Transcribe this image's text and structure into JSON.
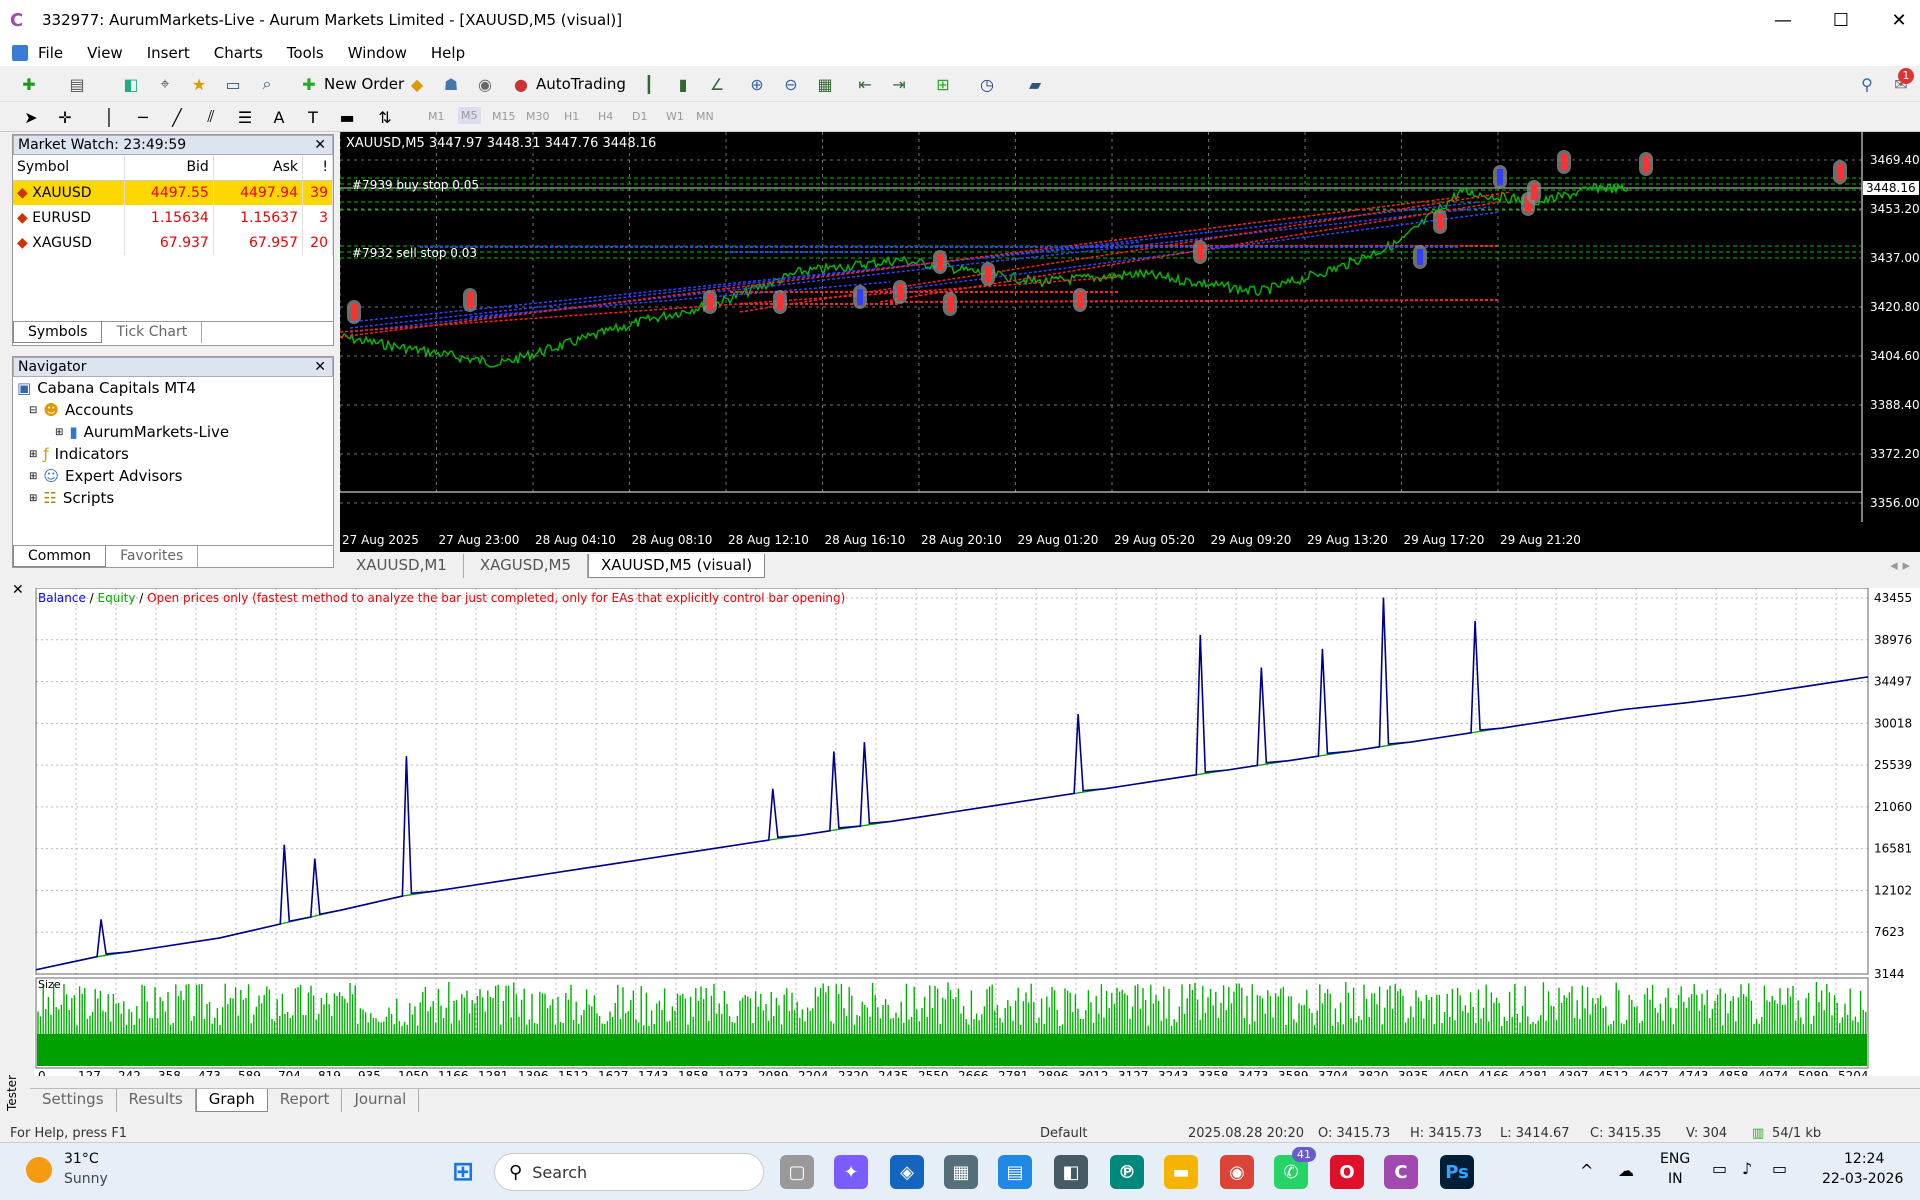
{
  "window": {
    "title": "332977: AurumMarkets-Live - Aurum Markets Limited - [XAUUSD,M5 (visual)]",
    "min": "—",
    "max": "☐",
    "close": "✕"
  },
  "menu": [
    "File",
    "View",
    "Insert",
    "Charts",
    "Tools",
    "Window",
    "Help"
  ],
  "toolbar": {
    "new_order": "New Order",
    "autotrading": "AutoTrading",
    "timeframes": [
      "M1",
      "M5",
      "M15",
      "M30",
      "H1",
      "H4",
      "D1",
      "W1",
      "MN"
    ],
    "alert_count": "1"
  },
  "market_watch": {
    "title": "Market Watch: 23:49:59",
    "headers": {
      "symbol": "Symbol",
      "bid": "Bid",
      "ask": "Ask",
      "spread": "!"
    },
    "rows": [
      {
        "symbol": "XAUUSD",
        "bid": "4497.55",
        "ask": "4497.94",
        "spread": "39"
      },
      {
        "symbol": "EURUSD",
        "bid": "1.15634",
        "ask": "1.15637",
        "spread": "3"
      },
      {
        "symbol": "XAGUSD",
        "bid": "67.937",
        "ask": "67.957",
        "spread": "20"
      }
    ],
    "tabs": [
      "Symbols",
      "Tick Chart"
    ]
  },
  "navigator": {
    "title": "Navigator",
    "root": "Cabana Capitals MT4",
    "accounts": "Accounts",
    "account": "AurumMarkets-Live",
    "indicators": "Indicators",
    "experts": "Expert Advisors",
    "scripts": "Scripts",
    "tabs": [
      "Common",
      "Favorites"
    ]
  },
  "price_chart": {
    "header": "XAUUSD,M5  3447.97 3448.31 3447.76 3448.16",
    "order_label_buy": "#7939 buy stop 0.05",
    "order_label_sell": "#7932 sell stop 0.03",
    "current_price": "3448.16",
    "y_ticks": [
      "3469.40",
      "3453.20",
      "3437.00",
      "3420.80",
      "3404.60",
      "3388.40",
      "3372.20",
      "3356.00"
    ],
    "x_ticks": [
      "27 Aug 2025",
      "27 Aug 23:00",
      "28 Aug 04:10",
      "28 Aug 08:10",
      "28 Aug 12:10",
      "28 Aug 16:10",
      "28 Aug 20:10",
      "29 Aug 01:20",
      "29 Aug 05:20",
      "29 Aug 09:20",
      "29 Aug 13:20",
      "29 Aug 17:20",
      "29 Aug 21:20"
    ],
    "colors": {
      "price": "#00c000",
      "buy": "#3040ff",
      "sell": "#ff2020",
      "grid": "#707070"
    }
  },
  "chart_tabs": [
    "XAUUSD,M1",
    "XAGUSD,M5",
    "XAUUSD,M5 (visual)"
  ],
  "tester_graph": {
    "legend_balance": "Balance",
    "legend_sep1": " / ",
    "legend_equity": "Equity",
    "legend_sep2": " / ",
    "legend_mode": "Open prices only (fastest method to analyze the bar just completed, only for EAs that explicitly control bar opening)",
    "y_ticks": [
      "43455",
      "38976",
      "34497",
      "30018",
      "25539",
      "21060",
      "16581",
      "12102",
      "7623",
      "3144"
    ],
    "x_ticks": [
      "0",
      "127",
      "242",
      "358",
      "473",
      "589",
      "704",
      "819",
      "935",
      "1050",
      "1166",
      "1281",
      "1396",
      "1512",
      "1627",
      "1743",
      "1858",
      "1973",
      "2089",
      "2204",
      "2320",
      "2435",
      "2550",
      "2666",
      "2781",
      "2896",
      "3012",
      "3127",
      "3243",
      "3358",
      "3473",
      "3589",
      "3704",
      "3820",
      "3935",
      "4050",
      "4166",
      "4281",
      "4397",
      "4512",
      "4627",
      "4743",
      "4858",
      "4974",
      "5089",
      "5204"
    ],
    "size_label": "Size",
    "side_label": "Tester",
    "colors": {
      "balance": "#000090",
      "equity": "#00a000",
      "size": "#00b000"
    }
  },
  "chart_data": [
    {
      "type": "line",
      "title": "",
      "series": [
        {
          "name": "Balance",
          "values": [
            3600,
            5000,
            6000,
            7000,
            8500,
            10000,
            11500,
            12500,
            13500,
            14500,
            15500,
            16500,
            17500,
            18500,
            19500,
            20500,
            21500,
            22500,
            23500,
            24500,
            25500,
            26500,
            27500,
            28500,
            29500,
            30500,
            31500,
            32200,
            33000,
            34000,
            35000
          ]
        },
        {
          "name": "Equity",
          "values": [
            3600,
            5000,
            6000,
            7000,
            8500,
            10000,
            11500,
            12500,
            13500,
            14500,
            15500,
            16500,
            17500,
            18500,
            19500,
            20500,
            21500,
            22500,
            23500,
            24500,
            25500,
            26500,
            27500,
            28500,
            29500,
            30500,
            31500,
            32200,
            33000,
            34000,
            35000
          ]
        }
      ],
      "ylim": [
        3144,
        43455
      ]
    }
  ],
  "tester_tabs": [
    "Settings",
    "Results",
    "Graph",
    "Report",
    "Journal"
  ],
  "status": {
    "help": "For Help, press F1",
    "profile": "Default",
    "time": "2025.08.28 20:20",
    "o": "O: 3415.73",
    "h": "H: 3415.73",
    "l": "L: 3414.67",
    "c": "C: 3415.35",
    "v": "V: 304",
    "traffic": "54/1 kb"
  },
  "taskbar": {
    "temp": "31°C",
    "weather": "Sunny",
    "search": "Search",
    "lang1": "ENG",
    "lang2": "IN",
    "time": "12:24",
    "date": "22-03-2026",
    "whatsapp_badge": "41"
  }
}
